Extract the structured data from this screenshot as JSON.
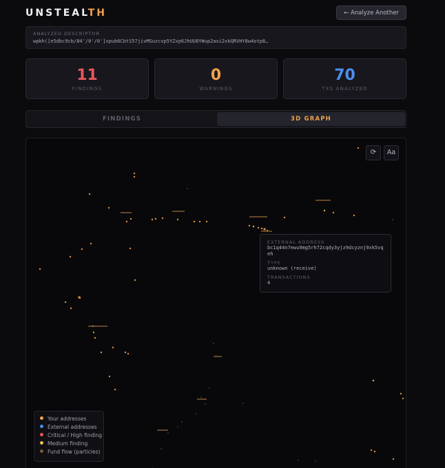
{
  "header": {
    "logo_main": "UNSTEAL",
    "logo_accent": "TH",
    "analyze_label": "← Analyze Another"
  },
  "descriptor": {
    "label": "ANALYZED DESCRIPTOR",
    "value": "wpkh([e5dbc9cb/84'/0'/0']xpub6CbtS57jivMSuzcvp5YZxp6JhUU8YWup2axi2xkQRVHY8w4otp8…"
  },
  "stats": [
    {
      "value": "11",
      "label": "FINDINGS",
      "color": "#e8565b"
    },
    {
      "value": "0",
      "label": "WARNINGS",
      "color": "#f0a14e"
    },
    {
      "value": "70",
      "label": "TXS ANALYZED",
      "color": "#4b8ff0"
    }
  ],
  "tabs": {
    "findings": "FINDINGS",
    "graph": "3D GRAPH"
  },
  "graph": {
    "controls": {
      "reset_icon": "⟳",
      "font_label": "Aa"
    },
    "tooltip": {
      "address_label": "EXTERNAL ADDRESS",
      "address": "bc1q44n7ewu9mg5rh72cqdy3yjz9dcyznj9xk5vqeh",
      "type_label": "TYPE",
      "type_value": "unknown (receive)",
      "tx_label": "TRANSACTIONS",
      "tx_value": "4"
    },
    "legend": [
      {
        "label": "Your addresses",
        "color": "#f0a14e"
      },
      {
        "label": "External addresses",
        "color": "#4b8ff0"
      },
      {
        "label": "Critical / High finding",
        "color": "#e8565b"
      },
      {
        "label": "Medium finding",
        "color": "#e8c14e"
      },
      {
        "label": "Fund flow (particles)",
        "color": "#7a5a36"
      }
    ]
  }
}
